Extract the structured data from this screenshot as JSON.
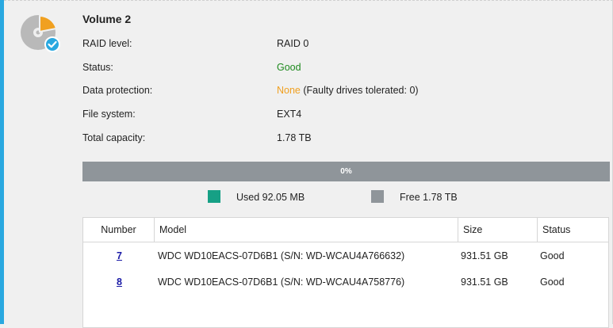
{
  "colors": {
    "accent": "#29a8e0",
    "good": "#1e8a1e",
    "warning": "#f0a020",
    "used": "#16a085",
    "free": "#8f959a",
    "link": "#1a1aa6"
  },
  "volume": {
    "title": "Volume 2",
    "icon": "disk-volume-icon",
    "badge_icon": "check-badge-icon",
    "properties": {
      "raid_level": {
        "label": "RAID level:",
        "value": "RAID 0"
      },
      "status": {
        "label": "Status:",
        "value": "Good"
      },
      "data_protection": {
        "label": "Data protection:",
        "value": "None",
        "detail": "(Faulty drives tolerated: 0)"
      },
      "file_system": {
        "label": "File system:",
        "value": "EXT4"
      },
      "total_capacity": {
        "label": "Total capacity:",
        "value": "1.78 TB"
      }
    }
  },
  "capacity": {
    "used_fraction": 0.0,
    "percent_label": "0%",
    "legend": {
      "used": "Used 92.05 MB",
      "free": "Free 1.78 TB"
    }
  },
  "disk_table": {
    "headers": {
      "number": "Number",
      "model": "Model",
      "size": "Size",
      "status": "Status"
    },
    "rows": [
      {
        "number": "7",
        "model": "WDC WD10EACS-07D6B1 (S/N: WD-WCAU4A766632)",
        "size": "931.51 GB",
        "status": "Good"
      },
      {
        "number": "8",
        "model": "WDC WD10EACS-07D6B1 (S/N: WD-WCAU4A758776)",
        "size": "931.51 GB",
        "status": "Good"
      }
    ]
  }
}
